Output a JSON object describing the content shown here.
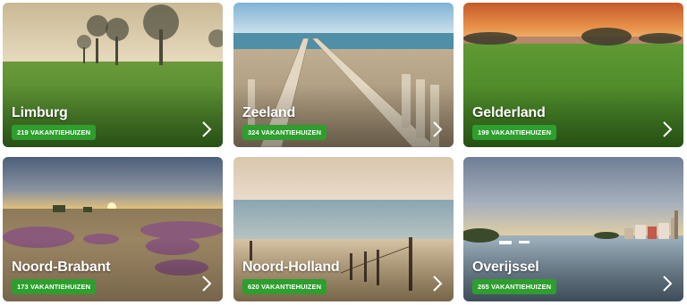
{
  "regions": [
    {
      "name": "Limburg",
      "count_label": "219 VAKANTIEHUIZEN"
    },
    {
      "name": "Zeeland",
      "count_label": "324 VAKANTIEHUIZEN"
    },
    {
      "name": "Gelderland",
      "count_label": "199 VAKANTIEHUIZEN"
    },
    {
      "name": "Noord-Brabant",
      "count_label": "173 VAKANTIEHUIZEN"
    },
    {
      "name": "Noord-Holland",
      "count_label": "620 VAKANTIEHUIZEN"
    },
    {
      "name": "Overijssel",
      "count_label": "265 VAKANTIEHUIZEN"
    }
  ],
  "colors": {
    "badge": "#2e9e2e",
    "text": "#ffffff"
  },
  "icons": {
    "next": "chevron-right-icon"
  }
}
